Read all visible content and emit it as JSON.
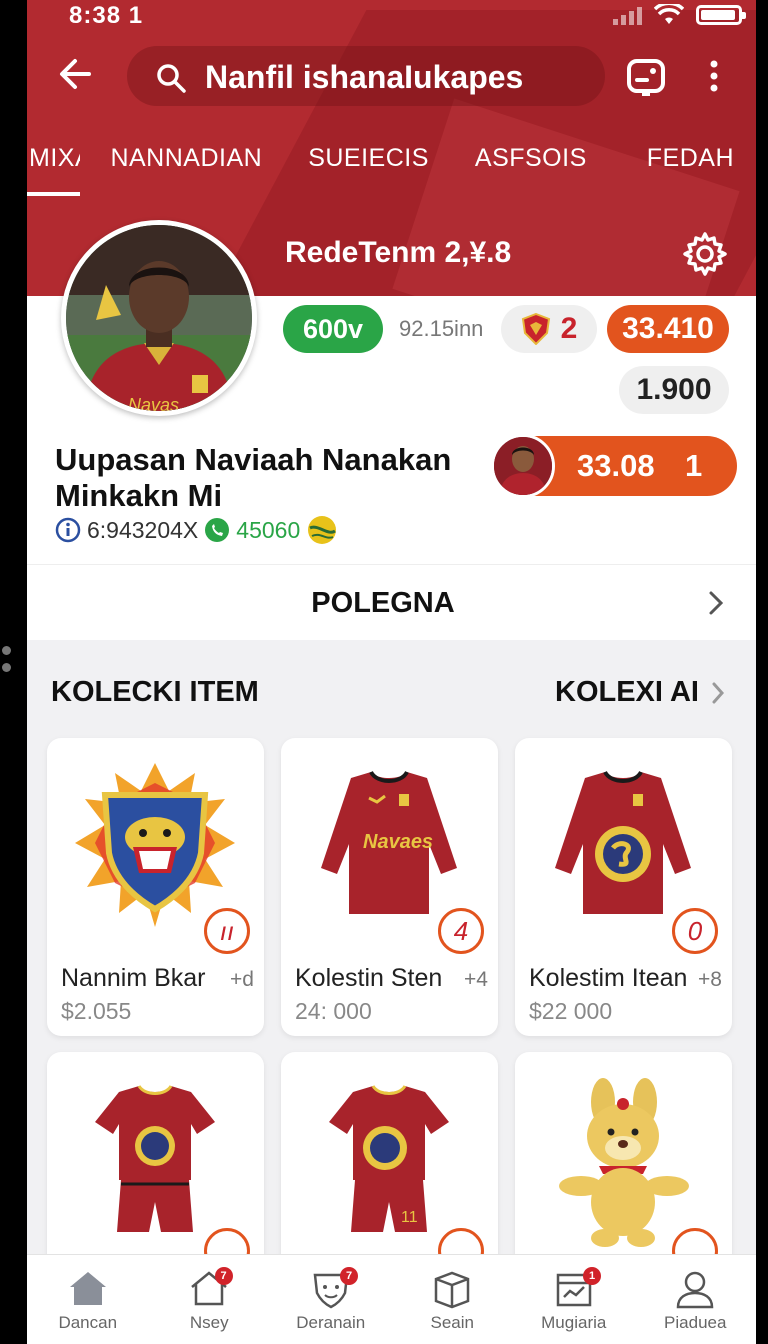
{
  "status_bar": {
    "time": "8:38 1"
  },
  "header": {
    "search_query": "Nanfil ishanaIukapes",
    "tabs": [
      "MIXAIN",
      "NANNADIAN",
      "SUEIECIS",
      "ASFSOIS",
      "FEDAH"
    ],
    "active_tab": 0,
    "team_title": "RedeTenm 2,¥.8"
  },
  "profile": {
    "badge_green": "600v",
    "sub_value": "92.15inn",
    "rank_value": "2",
    "orange_value": "33.410",
    "grey_value": "1.900",
    "name": "Uupasan Naviaah Nanakan Minkakn Mi",
    "stat_id": "6:943204X",
    "stat_coins": "45060",
    "featured_value": "33.08",
    "featured_count": "1",
    "more_label": "POLEGNA"
  },
  "collection": {
    "heading": "KOLECKI ITEM",
    "link": "KOLEXI AI",
    "items": [
      {
        "title": "Nannim Bkar",
        "qty": "+d",
        "price": "$2.055",
        "badge": "ıı",
        "icon": "crest-emblem"
      },
      {
        "title": "Kolestin Sten",
        "qty": "+4",
        "price": "24: 000",
        "badge": "4",
        "icon": "long-sleeve-jersey"
      },
      {
        "title": "Kolestim Itean",
        "qty": "+8",
        "price": "$22 000",
        "badge": "0",
        "icon": "long-sleeve-jersey-crest"
      },
      {
        "title": "",
        "qty": "",
        "price": "",
        "badge": "",
        "icon": "kit-with-shorts"
      },
      {
        "title": "",
        "qty": "",
        "price": "",
        "badge": "",
        "icon": "kit-with-shorts"
      },
      {
        "title": "",
        "qty": "",
        "price": "",
        "badge": "",
        "icon": "mascot-plush"
      }
    ]
  },
  "bottom_nav": [
    {
      "label": "Dancan",
      "icon": "home-icon",
      "badge": ""
    },
    {
      "label": "Nsey",
      "icon": "house-outline-icon",
      "badge": "7"
    },
    {
      "label": "Deranain",
      "icon": "shield-icon",
      "badge": "7"
    },
    {
      "label": "Seain",
      "icon": "box-icon",
      "badge": ""
    },
    {
      "label": "Mugiaria",
      "icon": "chart-icon",
      "badge": "1"
    },
    {
      "label": "Piaduea",
      "icon": "profile-icon",
      "badge": ""
    }
  ],
  "colors": {
    "brand_red": "#b22a30",
    "accent_orange": "#e2541e",
    "success_green": "#2aa547"
  }
}
